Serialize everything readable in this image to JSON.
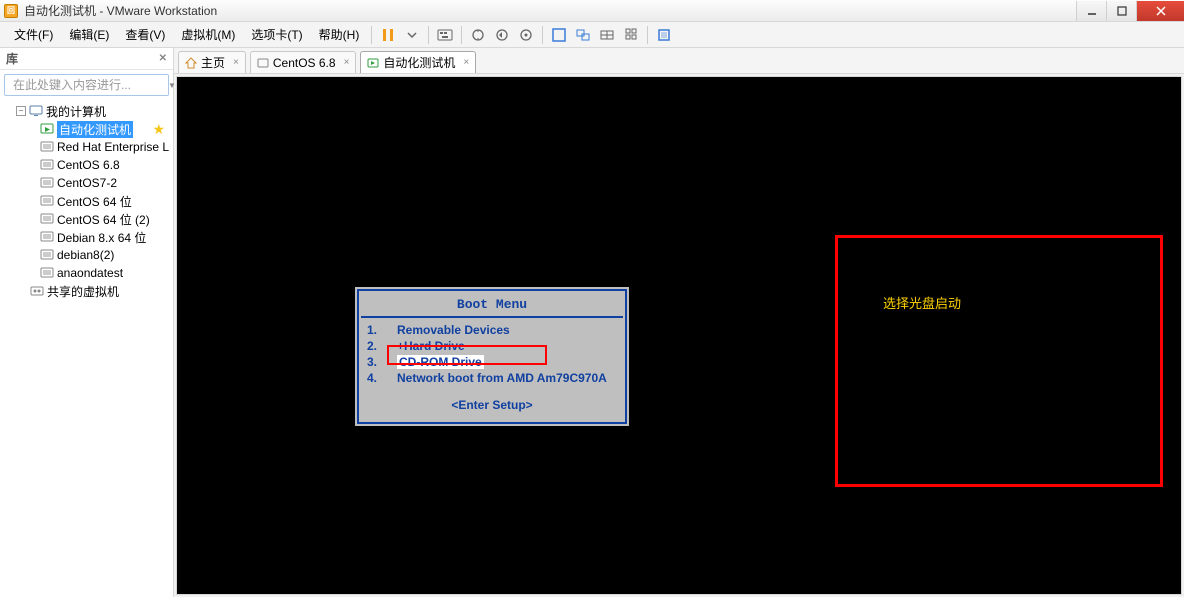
{
  "window": {
    "title": "自动化测试机 - VMware Workstation"
  },
  "menu": {
    "file": "文件(F)",
    "edit": "编辑(E)",
    "view": "查看(V)",
    "vm": "虚拟机(M)",
    "tabs": "选项卡(T)",
    "help": "帮助(H)"
  },
  "sidebar": {
    "header": "库",
    "search_placeholder": "在此处键入内容进行...",
    "root": "我的计算机",
    "items": [
      "自动化测试机",
      "Red Hat Enterprise L",
      "CentOS 6.8",
      "CentOS7-2",
      "CentOS 64 位",
      "CentOS 64 位 (2)",
      "Debian 8.x 64 位",
      "debian8(2)",
      "anaondatest"
    ],
    "shared": "共享的虚拟机"
  },
  "tabs": {
    "home": "主页",
    "t1": "CentOS 6.8",
    "t2": "自动化测试机"
  },
  "boot": {
    "title": "Boot Menu",
    "opt1": "Removable Devices",
    "opt2": "+Hard Drive",
    "opt3": "CD-ROM Drive",
    "opt4": "Network boot from AMD Am79C970A",
    "enter": "<Enter Setup>",
    "n1": "1.",
    "n2": "2.",
    "n3": "3.",
    "n4": "4."
  },
  "annotation": {
    "label": "选择光盘启动"
  }
}
